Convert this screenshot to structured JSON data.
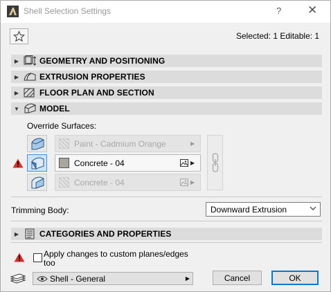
{
  "window": {
    "title": "Shell Selection Settings",
    "help_label": "?",
    "close_label": "✕"
  },
  "header": {
    "selection_info": "Selected: 1 Editable: 1"
  },
  "panels": [
    {
      "label": "GEOMETRY AND POSITIONING",
      "icon": "geometry-icon",
      "expanded": false
    },
    {
      "label": "EXTRUSION PROPERTIES",
      "icon": "extrusion-icon",
      "expanded": false
    },
    {
      "label": "FLOOR PLAN AND SECTION",
      "icon": "floor-plan-icon",
      "expanded": false
    },
    {
      "label": "MODEL",
      "icon": "model-icon",
      "expanded": true
    }
  ],
  "model": {
    "override_label": "Override Surfaces:",
    "surfaces": [
      {
        "name": "Paint - Cadmium Orange",
        "enabled": false
      },
      {
        "name": "Concrete - 04",
        "enabled": true
      },
      {
        "name": "Concrete - 04",
        "enabled": false
      }
    ],
    "trimming_label": "Trimming Body:",
    "trimming_value": "Downward Extrusion"
  },
  "categories_panel": {
    "label": "CATEGORIES AND PROPERTIES",
    "icon": "categories-icon",
    "expanded": false
  },
  "footer": {
    "apply_label": "Apply changes to custom planes/edges too",
    "apply_checked": false,
    "favorite_value": "Shell - General",
    "cancel_label": "Cancel",
    "ok_label": "OK"
  },
  "colors": {
    "panel_bg": "#dcdcdc",
    "accent": "#0078d7",
    "warning": "#d32f2f",
    "concrete_swatch": "#a9a69f"
  }
}
